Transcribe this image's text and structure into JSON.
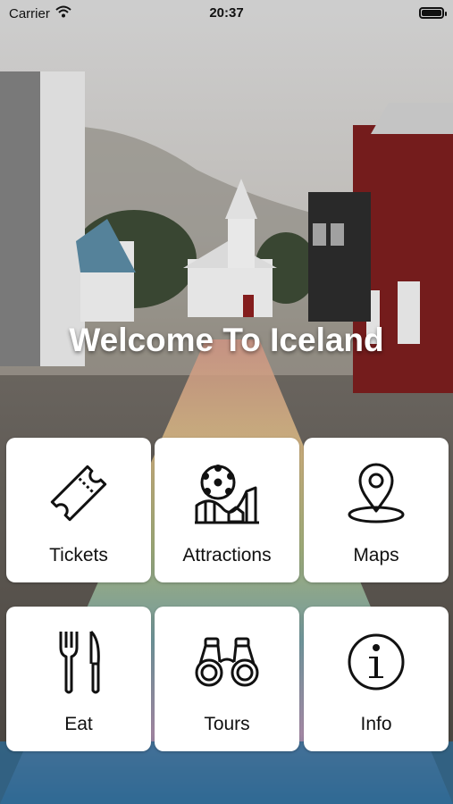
{
  "status_bar": {
    "carrier": "Carrier",
    "time": "20:37"
  },
  "hero": {
    "title": "Welcome To Iceland"
  },
  "tiles": [
    {
      "label": "Tickets",
      "icon": "ticket-icon"
    },
    {
      "label": "Attractions",
      "icon": "roller-coaster-icon"
    },
    {
      "label": "Maps",
      "icon": "map-pin-icon"
    },
    {
      "label": "Eat",
      "icon": "fork-knife-icon"
    },
    {
      "label": "Tours",
      "icon": "binoculars-icon"
    },
    {
      "label": "Info",
      "icon": "info-icon"
    }
  ]
}
